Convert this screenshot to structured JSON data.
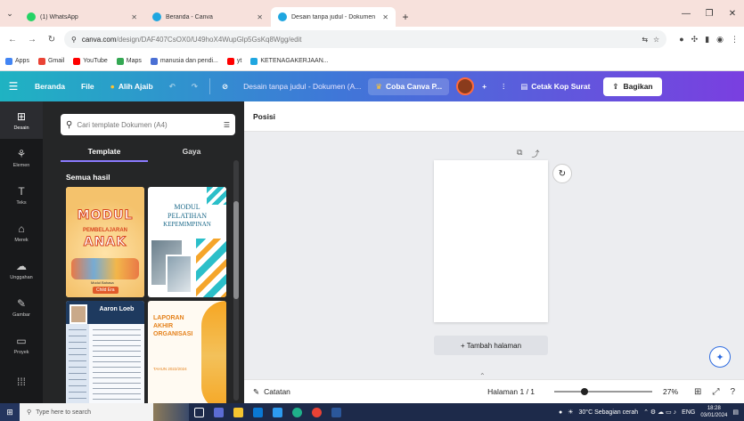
{
  "browser": {
    "tabs": [
      {
        "label": "(1) WhatsApp",
        "color": "#25d366",
        "active": false
      },
      {
        "label": "Beranda - Canva",
        "color": "#1fa6e0",
        "active": false
      },
      {
        "label": "Desain tanpa judul - Dokumen",
        "color": "#1fa6e0",
        "active": true
      }
    ],
    "url_host": "canva.com",
    "url_path": "/design/DAF407CsOX0/U49hoX4WupGlp5GsKq8Wgg/edit",
    "bookmarks": [
      {
        "label": "Apps",
        "color": "#4285f4"
      },
      {
        "label": "Gmail",
        "color": "#ea4335"
      },
      {
        "label": "YouTube",
        "color": "#ff0000"
      },
      {
        "label": "Maps",
        "color": "#34a853"
      },
      {
        "label": "manusia dan pendi...",
        "color": "#4a6fd4"
      },
      {
        "label": "yt",
        "color": "#ff0000"
      },
      {
        "label": "KETENAGAKERJAAN...",
        "color": "#1fa6e0"
      }
    ]
  },
  "canva": {
    "menu": [
      "Beranda",
      "File"
    ],
    "magic": "Alih Ajaib",
    "doc_title": "Desain tanpa judul - Dokumen (A...",
    "try_pro": "Coba Canva P...",
    "print_label": "Cetak Kop Surat",
    "share_label": "Bagikan",
    "rail": [
      {
        "label": "Desain",
        "icon": "layout-icon"
      },
      {
        "label": "Elemen",
        "icon": "shapes-icon"
      },
      {
        "label": "Teks",
        "icon": "text-icon"
      },
      {
        "label": "Merek",
        "icon": "brand-icon"
      },
      {
        "label": "Unggahan",
        "icon": "upload-icon"
      },
      {
        "label": "Gambar",
        "icon": "draw-icon"
      },
      {
        "label": "Proyek",
        "icon": "folder-icon"
      },
      {
        "label": "",
        "icon": "apps-icon"
      }
    ],
    "search_placeholder": "Cari template Dokumen (A4)",
    "panel_tabs": [
      "Template",
      "Gaya"
    ],
    "section_title": "Semua hasil",
    "templates": [
      {
        "name": "modul-anak",
        "lines": [
          "MODUL",
          "PEMBELAJARAN",
          "ANAK",
          "Modul Bahasa",
          "Child Era"
        ]
      },
      {
        "name": "modul-pelatihan",
        "lines": [
          "MODUL",
          "PELATIHAN",
          "KEPEMIMPINAN"
        ]
      },
      {
        "name": "cv-aaron",
        "lines": [
          "Aaron Loeb"
        ]
      },
      {
        "name": "laporan-akhir",
        "lines": [
          "LAPORAN",
          "AKHIR",
          "ORGANISASI",
          "TAHUN 2022/2024"
        ]
      }
    ],
    "toolbar_title": "Posisi",
    "add_page": "+ Tambah halaman",
    "notes_label": "Catatan",
    "page_label": "Halaman 1 / 1",
    "zoom": "27%",
    "zoom_fraction": 0.27
  },
  "taskbar": {
    "search_placeholder": "Type here to search",
    "weather": "30°C Sebagian cerah",
    "lang": "ENG",
    "time": "18:28",
    "date": "03/01/2024"
  }
}
